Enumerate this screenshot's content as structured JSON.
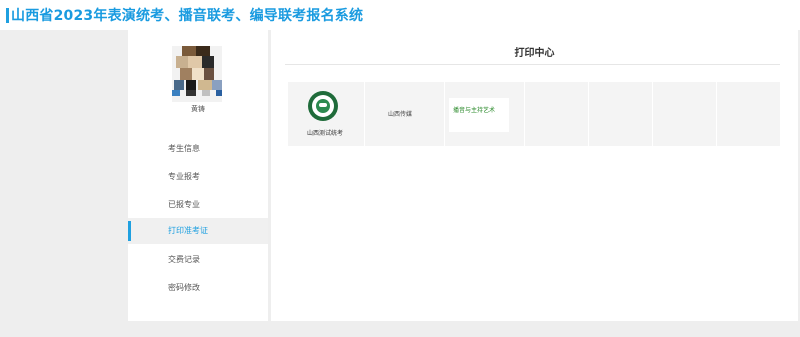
{
  "header": {
    "title": "山西省2023年表演统考、播音联考、编导联考报名系统"
  },
  "user": {
    "name": "黄铸",
    "avatar_icon": "avatar-icon"
  },
  "sidebar": {
    "items": [
      {
        "label": "考生信息",
        "active": false
      },
      {
        "label": "专业报考",
        "active": false
      },
      {
        "label": "已报专业",
        "active": false
      },
      {
        "label": "打印准考证",
        "active": true
      },
      {
        "label": "交费记录",
        "active": false
      },
      {
        "label": "密码修改",
        "active": false
      }
    ]
  },
  "main": {
    "title": "打印中心",
    "entry": {
      "school_label": "山西测试统考",
      "school_icon": "school-logo-icon",
      "org_name": "山西传媒",
      "major": "播音与主持艺术"
    }
  },
  "colors": {
    "accent": "#1fa0e0",
    "major_text": "#2a8a2a",
    "logo_green": "#1f6b3a"
  }
}
